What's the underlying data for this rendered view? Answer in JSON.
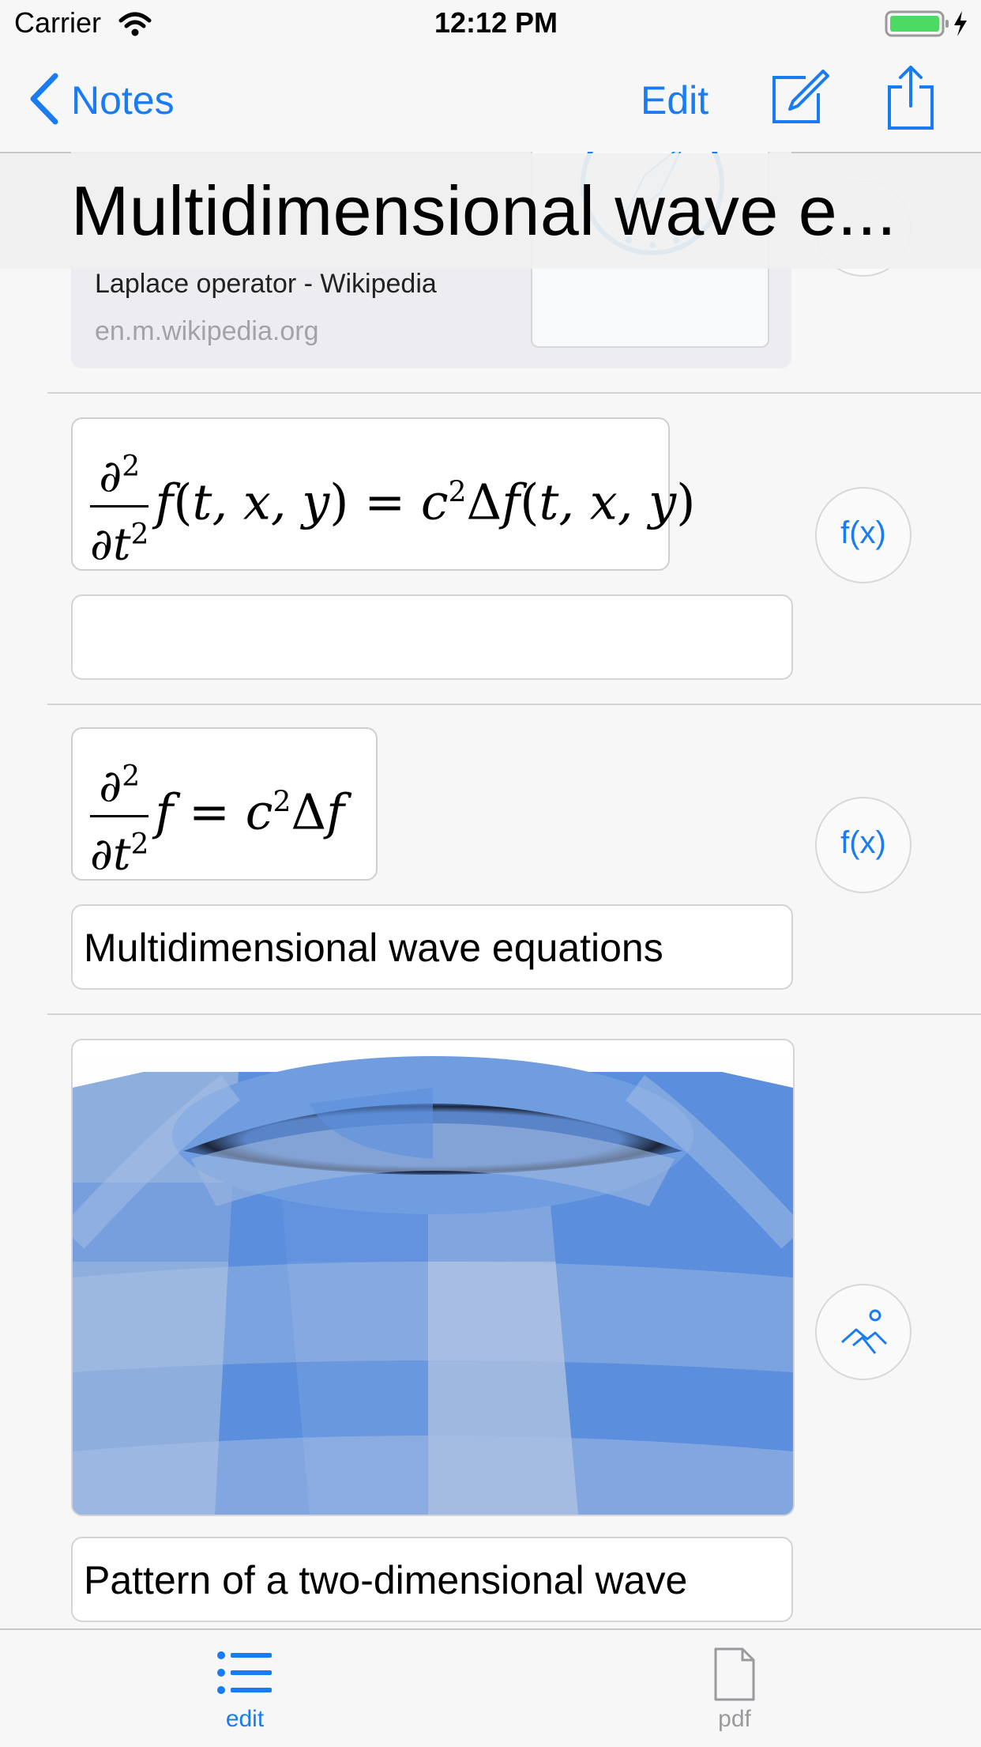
{
  "status_bar": {
    "carrier": "Carrier",
    "time": "12:12 PM"
  },
  "nav": {
    "back_label": "Notes",
    "edit_label": "Edit"
  },
  "title": "Multidimensional wave e...",
  "link_card": {
    "title": "Laplace operator - Wikipedia",
    "domain": "en.m.wikipedia.org"
  },
  "blocks": [
    {
      "type": "formula",
      "latex": "\\frac{\\partial^2}{\\partial t^2} f(t,x,y) = c^2 \\Delta f(t,x,y)",
      "caption": "",
      "button": "f(x)"
    },
    {
      "type": "formula",
      "latex": "\\frac{\\partial^2}{\\partial t^2} f = c^2 \\Delta f",
      "caption": "Multidimensional wave equations",
      "button": "f(x)"
    },
    {
      "type": "image",
      "caption": "Pattern of a two-dimensional wave",
      "button_icon": "image-icon"
    }
  ],
  "tabs": [
    {
      "label": "edit",
      "icon": "list-icon",
      "active": true
    },
    {
      "label": "pdf",
      "icon": "document-icon",
      "active": false
    }
  ],
  "colors": {
    "accent": "#1a7cf2",
    "battery": "#4cd964"
  }
}
